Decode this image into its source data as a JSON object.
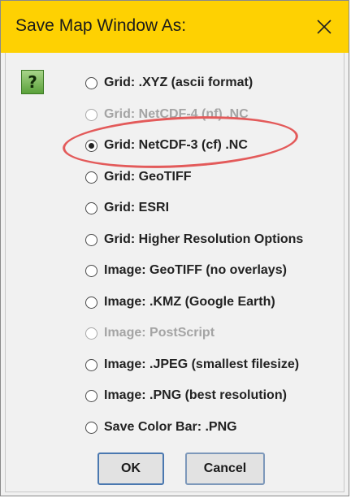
{
  "window": {
    "title": "Save Map Window As:",
    "close_symbol": "✕"
  },
  "help": {
    "icon_name": "question-mark-icon",
    "symbol": "?"
  },
  "options": [
    {
      "label": "Grid: .XYZ (ascii format)",
      "selected": false,
      "enabled": true
    },
    {
      "label": "Grid: NetCDF-4 (nf) .NC",
      "selected": false,
      "enabled": false
    },
    {
      "label": "Grid: NetCDF-3 (cf) .NC",
      "selected": true,
      "enabled": true
    },
    {
      "label": "Grid: GeoTIFF",
      "selected": false,
      "enabled": true
    },
    {
      "label": "Grid: ESRI",
      "selected": false,
      "enabled": true
    },
    {
      "label": "Grid: Higher Resolution Options",
      "selected": false,
      "enabled": true
    },
    {
      "label": "Image: GeoTIFF (no overlays)",
      "selected": false,
      "enabled": true
    },
    {
      "label": "Image: .KMZ (Google Earth)",
      "selected": false,
      "enabled": true
    },
    {
      "label": "Image: PostScript",
      "selected": false,
      "enabled": false
    },
    {
      "label": "Image: .JPEG (smallest filesize)",
      "selected": false,
      "enabled": true
    },
    {
      "label": "Image: .PNG (best resolution)",
      "selected": false,
      "enabled": true
    },
    {
      "label": "Save Color Bar: .PNG",
      "selected": false,
      "enabled": true
    }
  ],
  "buttons": {
    "ok_label": "OK",
    "cancel_label": "Cancel"
  },
  "colors": {
    "titlebar": "#fed102",
    "highlight": "#e35a5a",
    "help_green": "#5aa13a",
    "disabled_text": "#a4a4a4"
  }
}
